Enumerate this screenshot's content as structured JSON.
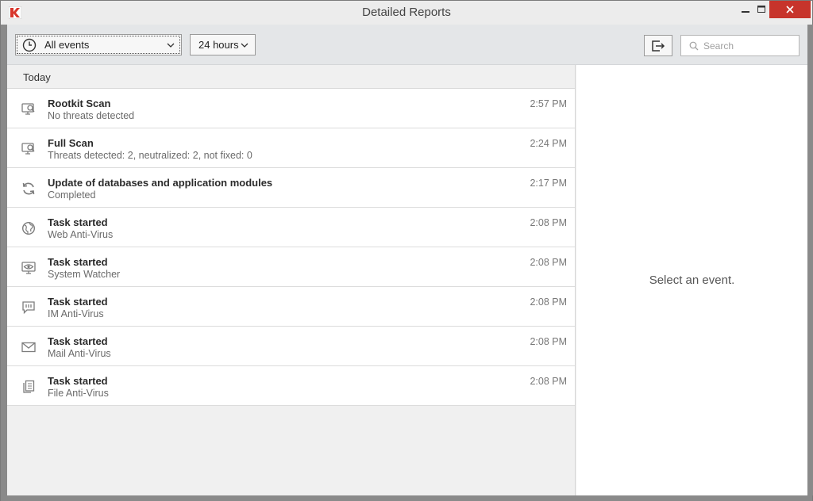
{
  "window": {
    "title": "Detailed Reports",
    "colors": {
      "close_button": "#c7342b",
      "logo_red": "#d8362b"
    }
  },
  "toolbar": {
    "event_filter": {
      "selected": "All events",
      "icon": "clock-icon"
    },
    "time_filter": {
      "selected": "24 hours"
    },
    "export_icon": "export-icon",
    "search": {
      "placeholder": "Search",
      "value": ""
    }
  },
  "list": {
    "group_label": "Today",
    "events": [
      {
        "title": "Rootkit Scan",
        "subtitle": "No threats detected",
        "time": "2:57 PM",
        "icon": "monitor-search-icon"
      },
      {
        "title": "Full Scan",
        "subtitle": "Threats detected: 2, neutralized: 2, not fixed: 0",
        "time": "2:24 PM",
        "icon": "monitor-search-icon"
      },
      {
        "title": "Update of databases and application modules",
        "subtitle": "Completed",
        "time": "2:17 PM",
        "icon": "refresh-icon"
      },
      {
        "title": "Task started",
        "subtitle": "Web Anti-Virus",
        "time": "2:08 PM",
        "icon": "globe-icon"
      },
      {
        "title": "Task started",
        "subtitle": "System Watcher",
        "time": "2:08 PM",
        "icon": "monitor-eye-icon"
      },
      {
        "title": "Task started",
        "subtitle": "IM Anti-Virus",
        "time": "2:08 PM",
        "icon": "chat-icon"
      },
      {
        "title": "Task started",
        "subtitle": "Mail Anti-Virus",
        "time": "2:08 PM",
        "icon": "mail-icon"
      },
      {
        "title": "Task started",
        "subtitle": "File Anti-Virus",
        "time": "2:08 PM",
        "icon": "files-icon"
      }
    ]
  },
  "detail": {
    "empty_message": "Select an event."
  }
}
